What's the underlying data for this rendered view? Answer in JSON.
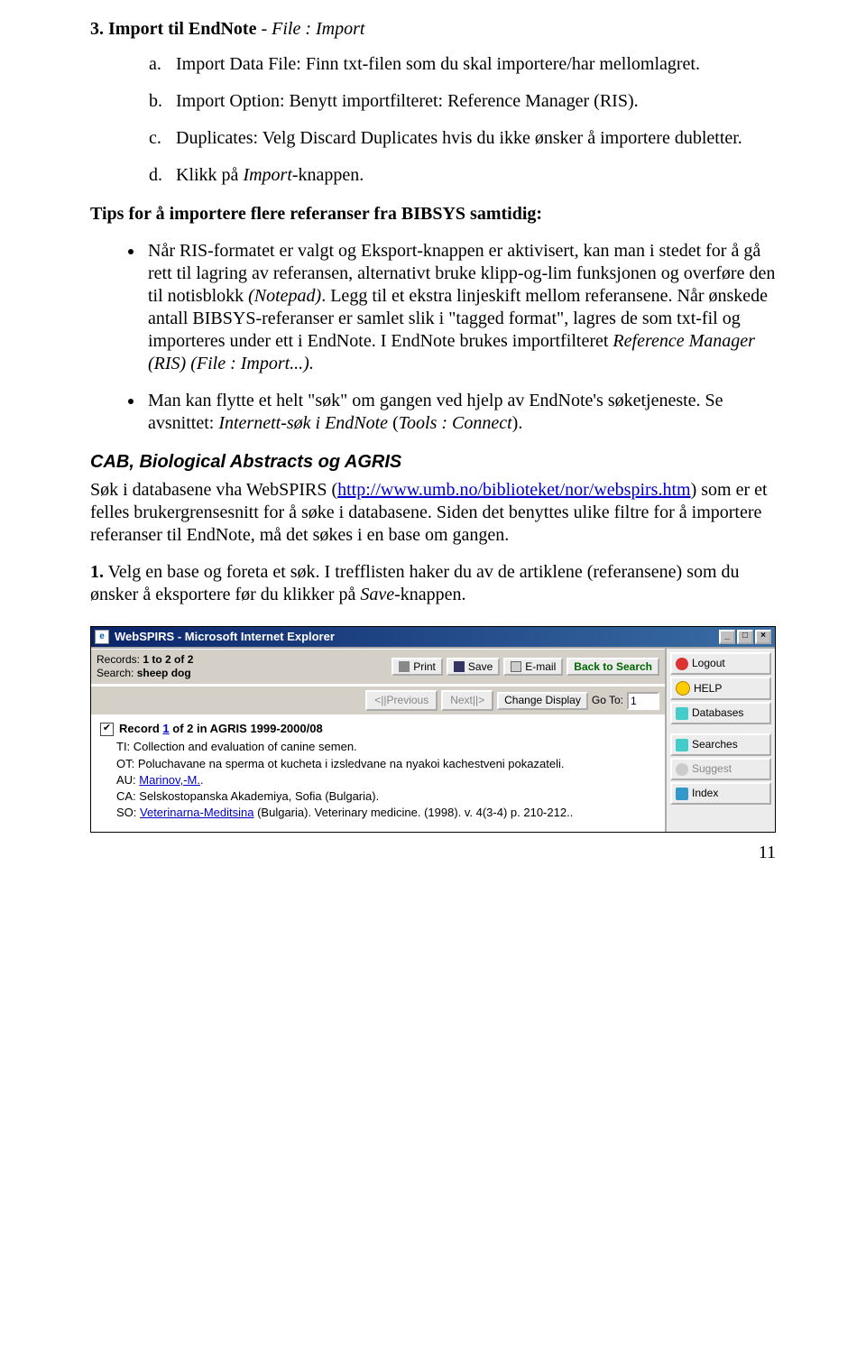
{
  "heading": {
    "number": "3.",
    "bold": "Import til EndNote",
    "sep": " - ",
    "italic": "File : Import"
  },
  "sub_items": [
    {
      "marker": "a.",
      "plain1": "Import Data File: Finn txt-filen som du skal importere/har mellomlagret."
    },
    {
      "marker": "b.",
      "plain1": "Import Option: Benytt importfilteret: Reference Manager (RIS)."
    },
    {
      "marker": "c.",
      "plain1": "Duplicates: Velg Discard Duplicates hvis du ikke ønsker å importere dubletter."
    },
    {
      "marker": "d.",
      "plain_prefix": "Klikk på ",
      "italic": "Import",
      "plain_suffix": "-knappen."
    }
  ],
  "tips_heading": "Tips for å importere flere referanser fra BIBSYS samtidig:",
  "bullets": [
    {
      "segments": [
        {
          "t": "Når RIS-formatet er valgt og Eksport-knappen er aktivisert, kan man i stedet for å gå rett til lagring av referansen, alternativt bruke klipp-og-lim funksjonen og overføre den til notisblokk "
        },
        {
          "t": "(Notepad)",
          "italic": true
        },
        {
          "t": ". Legg til et ekstra linjeskift mellom referansene. Når ønskede antall BIBSYS-referanser er samlet slik i \"tagged format\", lagres de som txt-fil og importeres under ett i EndNote. I EndNote brukes importfilteret "
        },
        {
          "t": "Reference Manager (RIS) (File : Import...).",
          "italic": true
        }
      ]
    },
    {
      "segments": [
        {
          "t": "Man kan flytte et helt \"søk\" om gangen ved hjelp av EndNote's søketjeneste. Se avsnittet: "
        },
        {
          "t": "Internett-søk i EndNote",
          "italic": true
        },
        {
          "t": " ("
        },
        {
          "t": "Tools : Connect",
          "italic": true
        },
        {
          "t": ")."
        }
      ]
    }
  ],
  "section_title": "CAB, Biological Abstracts og AGRIS",
  "para1": {
    "pre": "Søk i databasene vha WebSPIRS (",
    "url_text": "http://www.umb.no/biblioteket/nor/webspirs.htm",
    "post": ") som er et felles brukergrensesnitt for å søke i databasene. Siden det benyttes ulike filtre for å importere referanser til EndNote, må det søkes i en base om gangen."
  },
  "step1": {
    "num": "1.",
    "pre": " Velg en base og foreta et søk. I trefflisten haker du av de artiklene (referansene) som du ønsker å eksportere før du klikker på ",
    "italic": "Save",
    "post": "-knappen."
  },
  "browser": {
    "title": "WebSPIRS - Microsoft Internet Explorer",
    "toolbar": {
      "records_label": "Records:",
      "records_value": "1 to 2 of 2",
      "search_label": "Search:",
      "search_value": "sheep dog",
      "print": "Print",
      "save": "Save",
      "email": "E-mail",
      "back": "Back to Search",
      "prev": "<||Previous",
      "next": "Next||>",
      "change_display": "Change Display",
      "goto": "Go To:",
      "goto_value": "1"
    },
    "record": {
      "head_pre": "Record ",
      "head_link": "1",
      "head_post": " of 2 in AGRIS 1999-2000/08",
      "ti": "TI: Collection and evaluation of canine semen.",
      "ot": "OT: Poluchavane na sperma ot kucheta i izsledvane na nyakoi kachestveni pokazateli.",
      "au_label": "AU: ",
      "au_link": "Marinov,-M.",
      "au_post": ".",
      "ca": "CA: Selskostopanska Akademiya, Sofia (Bulgaria).",
      "so_label": "SO: ",
      "so_link": "Veterinarna-Meditsina",
      "so_post": " (Bulgaria). Veterinary medicine. (1998). v. 4(3-4) p. 210-212.."
    },
    "side": {
      "logout": "Logout",
      "help": "HELP",
      "databases": "Databases",
      "searches": "Searches",
      "suggest": "Suggest",
      "index": "Index"
    }
  },
  "page_number": "11"
}
